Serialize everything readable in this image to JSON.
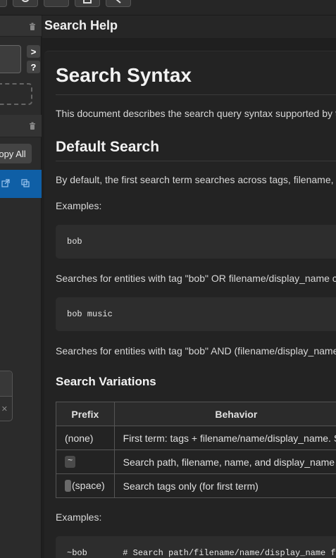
{
  "sidebar": {
    "help_button": "?",
    "expand_button": ">",
    "copy_all": "opy All"
  },
  "header": {
    "title": "Search Help"
  },
  "doc": {
    "h1": "Search Syntax",
    "intro": "This document describes the search query syntax supported by t",
    "h2_default": "Default Search",
    "default_desc": "By default, the first search term searches across tags, filename,",
    "examples_label": "Examples:",
    "code1": "bob",
    "code1_desc": "Searches for entities with tag \"bob\" OR filename/display_name c",
    "code2": "bob music",
    "code2_desc": "Searches for entities with tag \"bob\" AND (filename/display_name",
    "h3_variations": "Search Variations",
    "table": {
      "headers": [
        "Prefix",
        "Behavior"
      ],
      "rows": [
        {
          "prefix": "(none)",
          "behavior": "First term: tags + filename/name/display_name. S"
        },
        {
          "prefix": "~",
          "behavior": "Search path, filename, name, and display_name"
        },
        {
          "prefix": "(space)",
          "behavior": "Search tags only (for first term)"
        }
      ]
    },
    "examples_label2": "Examples:",
    "code3": "~bob       # Search path/filename/name/display_name fo"
  }
}
